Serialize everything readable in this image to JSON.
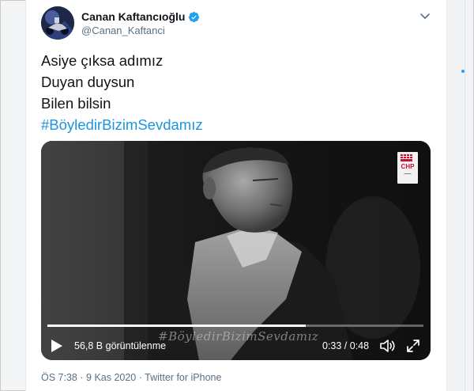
{
  "user": {
    "display_name": "Canan Kaftancıoğlu",
    "handle": "@Canan_Kaftanci",
    "verified": true
  },
  "tweet": {
    "lines": [
      "Asiye çıksa adımız",
      "Duyan duysun",
      "Bilen bilsin"
    ],
    "hashtag": "#BöyledirBizimSevdamız"
  },
  "video": {
    "views": "56,8 B görüntülenme",
    "time": "0:33 / 0:48",
    "progress_fraction": 0.6875,
    "watermark": "#BöyledirBizimSevdamız",
    "logo": {
      "text": "CHP"
    }
  },
  "meta": {
    "time": "ÖS 7:38",
    "sep1": "·",
    "date": "9 Kas 2020",
    "sep2": "·",
    "source": "Twitter for iPhone"
  },
  "colors": {
    "hashtag": "#1b95e0",
    "verified": "#1da1f2",
    "secondary_text": "#5b7083",
    "logo_red": "#c8102e"
  },
  "icons": {
    "more": "chevron-down-icon",
    "verified": "verified-badge-icon",
    "play": "play-icon",
    "volume": "volume-icon",
    "fullscreen": "fullscreen-icon"
  }
}
